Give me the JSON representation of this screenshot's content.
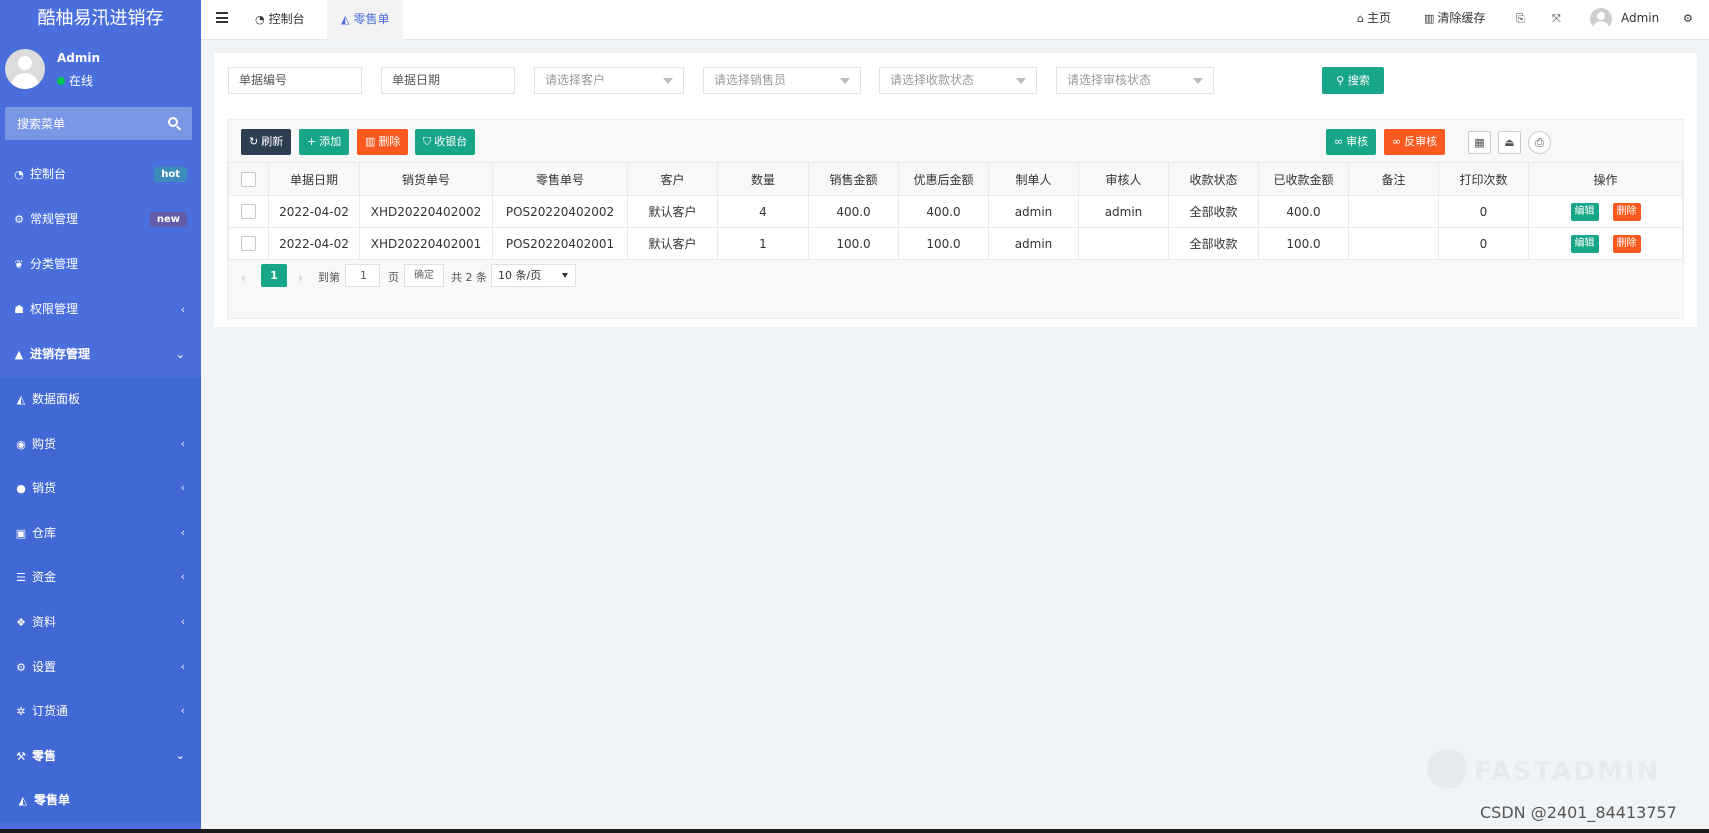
{
  "sidebar": {
    "brand": "酷柚易汛进销存",
    "user_name": "Admin",
    "user_status": "在线",
    "search_placeholder": "搜索菜单",
    "items": [
      {
        "label": "控制台",
        "icon": "dashboard-icon",
        "badge": "hot"
      },
      {
        "label": "常规管理",
        "icon": "cogs-icon",
        "badge": "new"
      },
      {
        "label": "分类管理",
        "icon": "leaf-icon"
      },
      {
        "label": "权限管理",
        "icon": "group-icon"
      },
      {
        "label": "进销存管理",
        "icon": "graduation-cap-icon"
      },
      {
        "label": "数据面板",
        "icon": "area-chart-icon"
      },
      {
        "label": "购货",
        "icon": "cart-icon"
      },
      {
        "label": "销货",
        "icon": "apple-icon"
      },
      {
        "label": "仓库",
        "icon": "warehouse-icon"
      },
      {
        "label": "资金",
        "icon": "database-icon"
      },
      {
        "label": "资料",
        "icon": "cubes-icon"
      },
      {
        "label": "设置",
        "icon": "cogs-icon"
      },
      {
        "label": "订货通",
        "icon": "yelp-icon"
      },
      {
        "label": "零售",
        "icon": "gavel-icon"
      },
      {
        "label": "零售单",
        "icon": "area-chart-icon"
      }
    ]
  },
  "header": {
    "tabs": [
      {
        "label": "控制台",
        "icon": "dashboard-icon"
      },
      {
        "label": "零售单",
        "icon": "area-chart-icon"
      }
    ],
    "home": "主页",
    "clear_cache": "清除缓存",
    "user": "Admin"
  },
  "filters": {
    "bill_no": "单据编号",
    "bill_date": "单据日期",
    "customer": "请选择客户",
    "salesman": "请选择销售员",
    "pay_status": "请选择收款状态",
    "audit_status": "请选择审核状态",
    "search_btn": "搜索"
  },
  "toolbar": {
    "refresh": "刷新",
    "add": "添加",
    "delete": "删除",
    "cashier": "收银台",
    "audit": "审核",
    "unaudit": "反审核"
  },
  "table": {
    "headers": [
      "单据日期",
      "销货单号",
      "零售单号",
      "客户",
      "数量",
      "销售金额",
      "优惠后金额",
      "制单人",
      "审核人",
      "收款状态",
      "已收款金额",
      "备注",
      "打印次数",
      "操作"
    ],
    "rows": [
      {
        "date": "2022-04-02",
        "sale_no": "XHD20220402002",
        "pos_no": "POS20220402002",
        "customer": "默认客户",
        "qty": "4",
        "amount": "400.0",
        "discounted": "400.0",
        "maker": "admin",
        "auditor": "admin",
        "pay_status": "全部收款",
        "received": "400.0",
        "remark": "",
        "prints": "0"
      },
      {
        "date": "2022-04-02",
        "sale_no": "XHD20220402001",
        "pos_no": "POS20220402001",
        "customer": "默认客户",
        "qty": "1",
        "amount": "100.0",
        "discounted": "100.0",
        "maker": "admin",
        "auditor": "",
        "pay_status": "全部收款",
        "received": "100.0",
        "remark": "",
        "prints": "0"
      }
    ],
    "edit_label": "编辑",
    "delete_label": "删除"
  },
  "pager": {
    "current": "1",
    "goto_label": "到第",
    "goto_value": "1",
    "page_label": "页",
    "confirm": "确定",
    "total": "共 2 条",
    "page_size": "10 条/页"
  },
  "watermark": "FASTADMIN",
  "credit": "CSDN @2401_84413757",
  "colors": {
    "sidebar": "#4a6fdc",
    "primary_green": "#18a689",
    "orange": "#fa5a1f",
    "dark": "#2c3e50"
  }
}
